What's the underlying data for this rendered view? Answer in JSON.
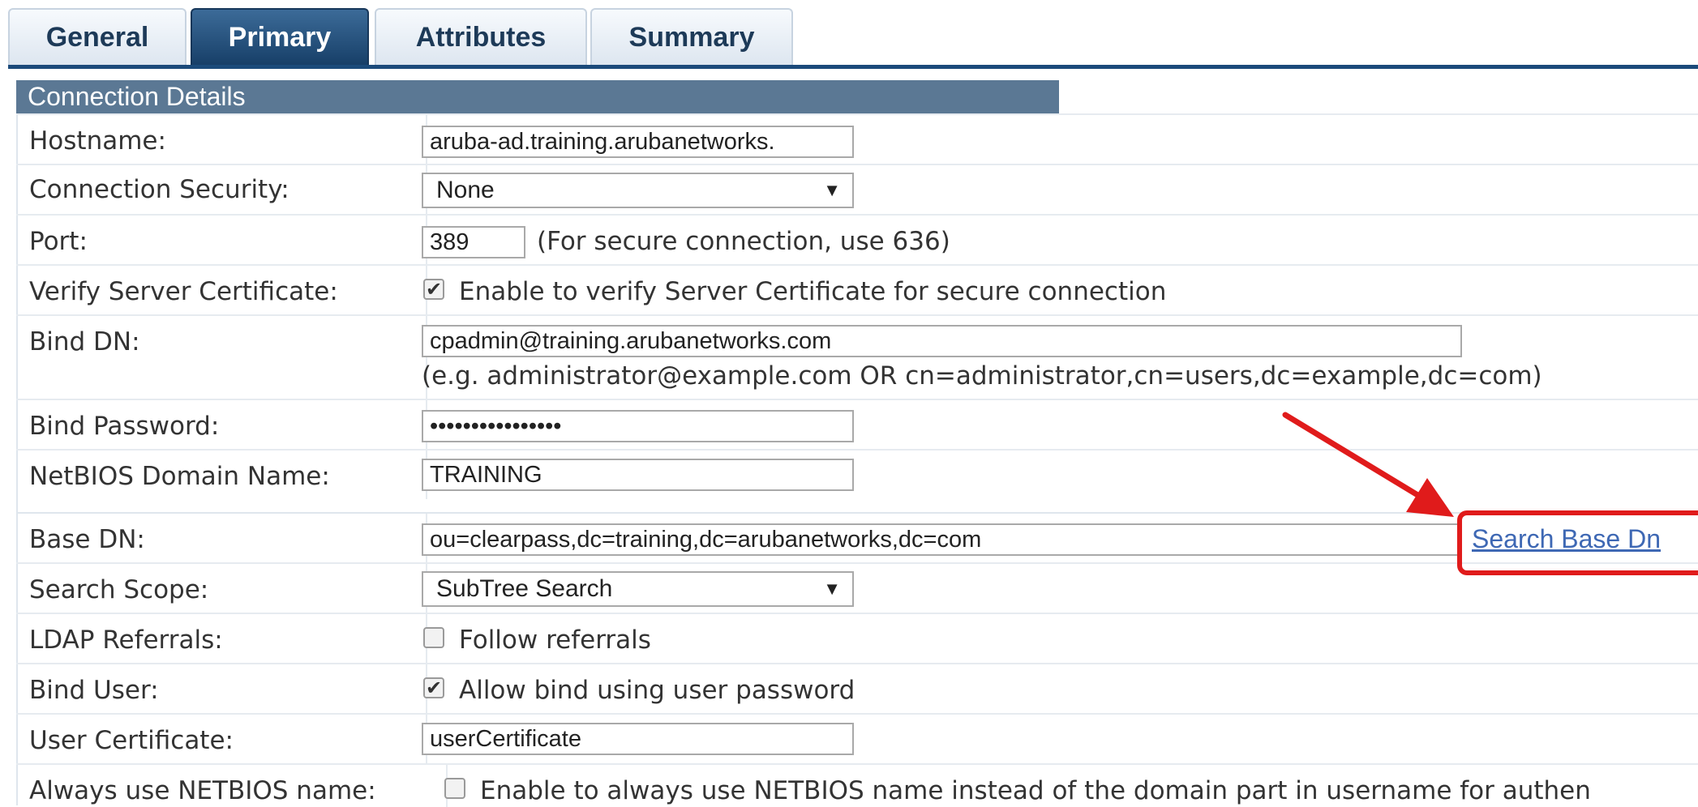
{
  "tabs": [
    {
      "label": "General",
      "active": false
    },
    {
      "label": "Primary",
      "active": true
    },
    {
      "label": "Attributes",
      "active": false
    },
    {
      "label": "Summary",
      "active": false
    }
  ],
  "section": {
    "title": "Connection Details"
  },
  "fields": {
    "hostname": {
      "label": "Hostname:",
      "value": "aruba-ad.training.arubanetworks."
    },
    "connection_security": {
      "label": "Connection Security:",
      "value": "None"
    },
    "port": {
      "label": "Port:",
      "value": "389",
      "hint": "(For secure connection, use 636)"
    },
    "verify_cert": {
      "label": "Verify Server Certificate:",
      "checked": true,
      "text": "Enable to verify Server Certificate for secure connection"
    },
    "bind_dn": {
      "label": "Bind DN:",
      "value": "cpadmin@training.arubanetworks.com",
      "hint": "(e.g. administrator@example.com OR cn=administrator,cn=users,dc=example,dc=com)"
    },
    "bind_password": {
      "label": "Bind Password:",
      "value": "••••••••••••••••"
    },
    "netbios": {
      "label": "NetBIOS Domain Name:",
      "value": "TRAINING"
    },
    "base_dn": {
      "label": "Base DN:",
      "value": "ou=clearpass,dc=training,dc=arubanetworks,dc=com",
      "link": "Search Base Dn"
    },
    "search_scope": {
      "label": "Search Scope:",
      "value": "SubTree Search"
    },
    "ldap_referrals": {
      "label": "LDAP Referrals:",
      "checked": false,
      "text": "Follow referrals"
    },
    "bind_user": {
      "label": "Bind User:",
      "checked": true,
      "text": "Allow bind using user password"
    },
    "user_certificate": {
      "label": "User Certificate:",
      "value": "userCertificate"
    },
    "always_netbios": {
      "label": "Always use NETBIOS name:",
      "checked": false,
      "text": "Enable to always use NETBIOS name instead of the domain part in username for authen"
    }
  },
  "colors": {
    "accent": "#1b4a7a",
    "section_header": "#5b7894",
    "link": "#3e68b4",
    "annotation": "#e01b1b"
  },
  "icons": {
    "dropdown": "triangle-down-icon",
    "check": "check-mark-icon"
  }
}
